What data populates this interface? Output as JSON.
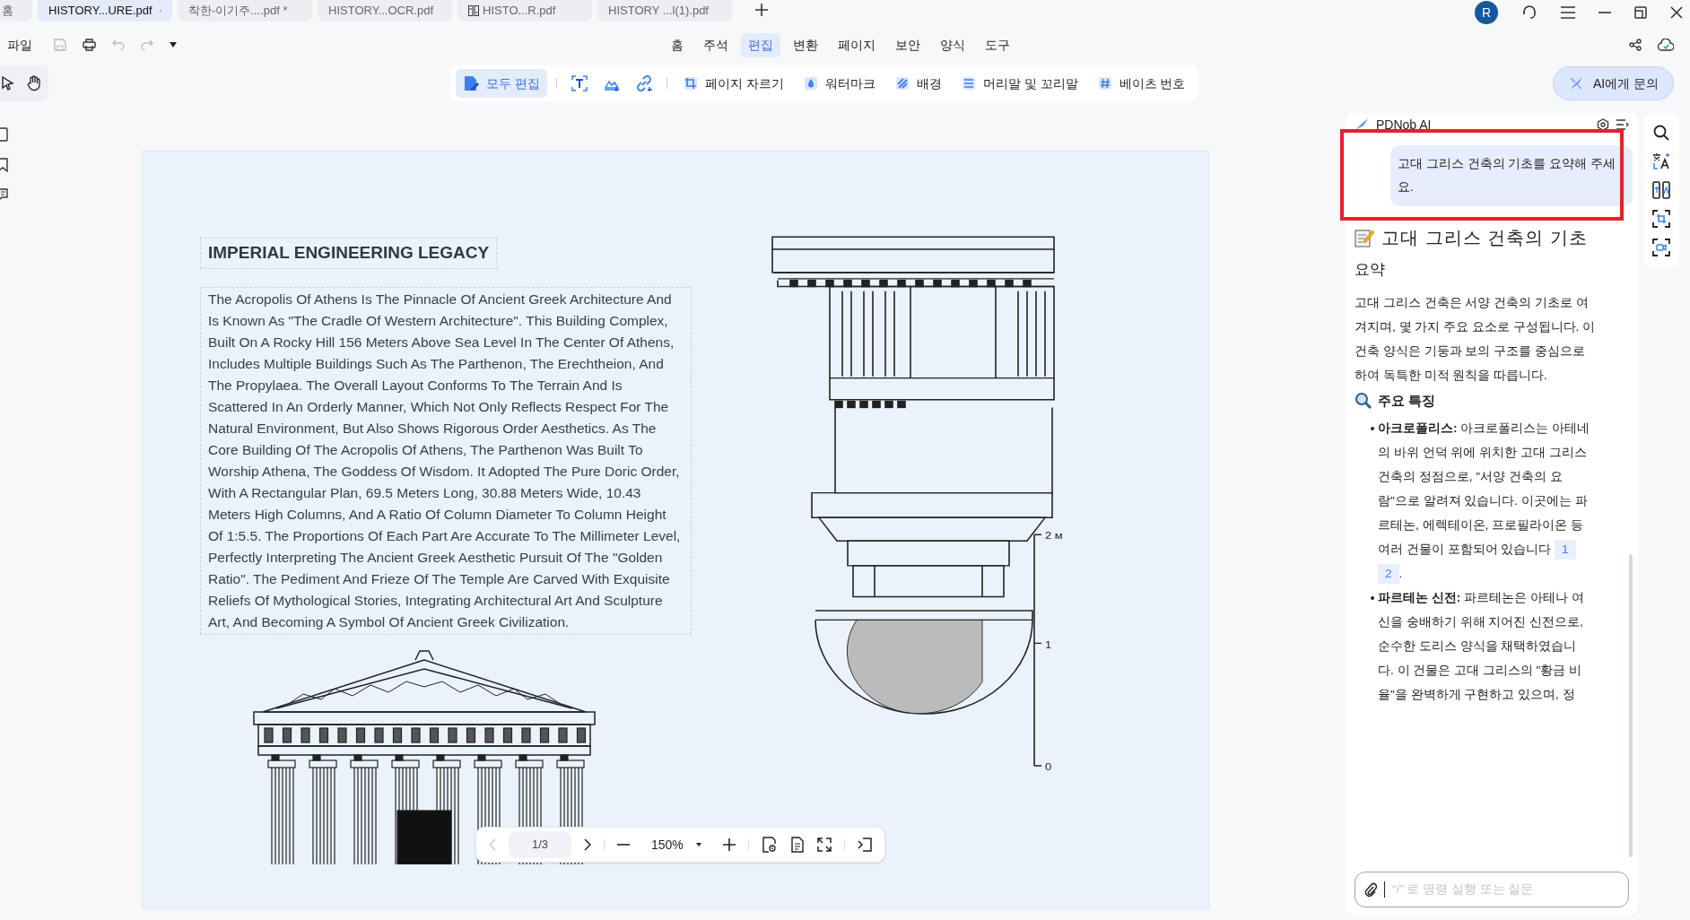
{
  "tabs": [
    {
      "label": "홈",
      "selected": false,
      "has_icon": false
    },
    {
      "label": "HISTORY...URE.pdf",
      "selected": true,
      "has_icon": false
    },
    {
      "label": "착한-이기주....pdf *",
      "selected": false,
      "has_icon": false
    },
    {
      "label": "HISTORY...OCR.pdf",
      "selected": false,
      "has_icon": false
    },
    {
      "label": "HISTO...R.pdf",
      "selected": false,
      "has_icon": true
    },
    {
      "label": "HISTORY ...l(1).pdf",
      "selected": false,
      "has_icon": false
    }
  ],
  "account": {
    "initial": "R"
  },
  "file_menu": "파일",
  "menu": [
    {
      "label": "홈",
      "selected": false
    },
    {
      "label": "주석",
      "selected": false
    },
    {
      "label": "편집",
      "selected": true
    },
    {
      "label": "변환",
      "selected": false
    },
    {
      "label": "페이지",
      "selected": false
    },
    {
      "label": "보안",
      "selected": false
    },
    {
      "label": "양식",
      "selected": false
    },
    {
      "label": "도구",
      "selected": false
    }
  ],
  "edit_toolbar": [
    {
      "kind": "labeled",
      "label": "모두 편집",
      "selected": true
    },
    {
      "kind": "icon",
      "selected": false
    },
    {
      "kind": "icon",
      "selected": false
    },
    {
      "kind": "icon",
      "selected": false
    },
    {
      "kind": "labeled",
      "label": "페이지 자르기",
      "selected": false
    },
    {
      "kind": "labeled",
      "label": "워터마크",
      "selected": false
    },
    {
      "kind": "labeled",
      "label": "배경",
      "selected": false
    },
    {
      "kind": "labeled",
      "label": "머리말 및 꼬리말",
      "selected": false
    },
    {
      "kind": "labeled",
      "label": "베이츠 번호",
      "selected": false
    }
  ],
  "ask_ai_button": "AI에게 문의",
  "document": {
    "heading": "IMPERIAL ENGINEERING LEGACY",
    "body": "The Acropolis Of Athens Is The Pinnacle Of Ancient Greek Architecture And Is Known As \"The Cradle Of Western Architecture\". This Building Complex, Built On A Rocky Hill 156 Meters Above Sea Level In The Center Of Athens, Includes Multiple Buildings Such As The Parthenon, The Erechtheion, And The Propylaea. The Overall Layout Conforms To The Terrain And Is Scattered In An Orderly Manner, Which Not Only Reflects Respect For The Natural Environment, But Also Shows Rigorous Order Aesthetics. As The Core Building Of The Acropolis Of Athens, The Parthenon Was Built To Worship Athena, The Goddess Of Wisdom. It Adopted The Pure Doric Order, With A Rectangular Plan, 69.5 Meters Long, 30.88 Meters Wide, 10.43 Meters High Columns, And A Ratio Of Column Diameter To Column Height Of 1:5.5. The Proportions Of Each Part Are Accurate To The Millimeter Level, Perfectly Interpreting The Ancient Greek Aesthetic Pursuit Of The \"Golden Ratio\". The Pediment And Frieze Of The Temple Are Carved With Exquisite Reliefs Of Mythological Stories, Integrating Architectural Art And Sculpture Art, And Becoming A Symbol Of Ancient Greek Civilization.",
    "scale_labels": [
      "2 м",
      "1",
      "0"
    ]
  },
  "page_nav": {
    "page": "1/3",
    "zoom": "150%"
  },
  "ai_panel": {
    "title": "PDNob AI",
    "user_message": {
      "text": "고대 그리스 건축의 기초를 요약해 주세요.",
      "highlighted": true
    },
    "response": {
      "title": "고대 그리스 건축의 기초",
      "subtitle": "요약",
      "summary": "고대 그리스 건축은 서양 건축의 기초로 여겨지며, 몇 가지 주요 요소로 구성됩니다. 이 건축 양식은 기둥과 보의 구조를 중심으로 하여 독특한 미적 원칙을 따릅니다.",
      "section_title": "주요 특징",
      "bullets": [
        {
          "text": "**아크로폴리스:** 아크로폴리스는 아테네의 바위 언덕 위에 위치한 고대 그리스 건축의 정점으로, \"서양 건축의 요람\"으로 알려져 있습니다. 이곳에는 파르테논, 에렉테이온, 프로필라이온 등 여러 건물이 포함되어 있습니다",
          "citations": [
            "1",
            "2"
          ],
          "tail": "."
        },
        {
          "text": "**파르테논 신전:** 파르테논은 아테나 여신을 숭배하기 위해 지어진 신전으로, 순수한 도리스 양식을 채택하였습니다. 이 건물은 고대 그리스의 \"황금 비율\"을 완벽하게 구현하고 있으며, 정"
        }
      ]
    },
    "input": {
      "placeholder": "“/” 로 명령 실행 또는 질문"
    }
  }
}
